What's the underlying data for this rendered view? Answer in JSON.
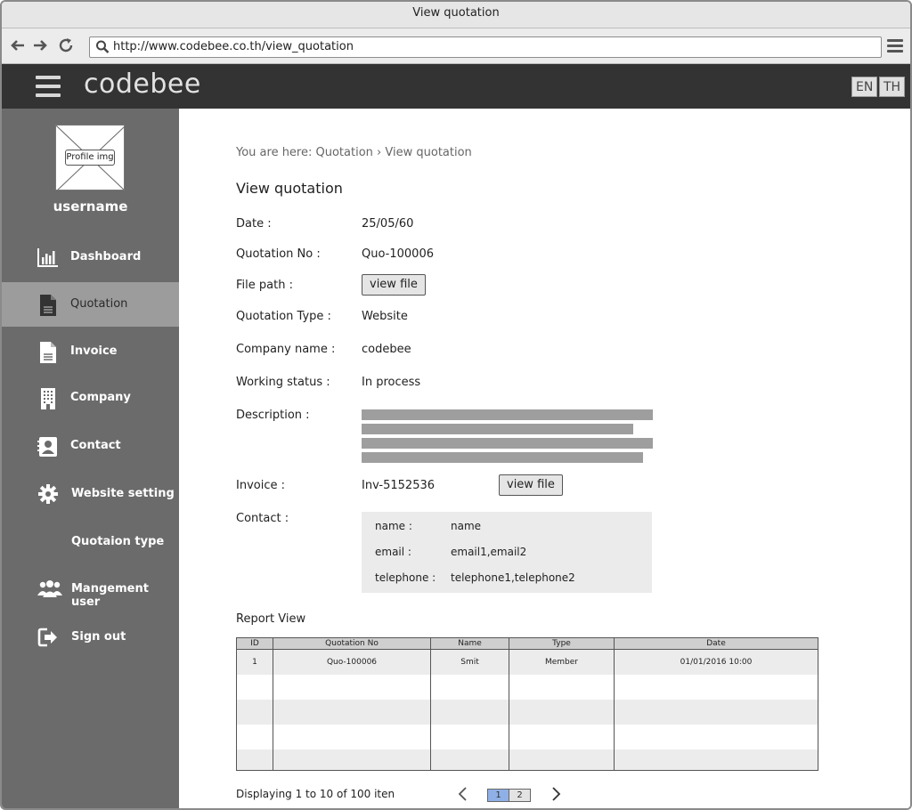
{
  "window": {
    "title": "View quotation"
  },
  "browser": {
    "url": "http://www.codebee.co.th/view_quotation"
  },
  "header": {
    "brand": "codebee",
    "lang_en": "EN",
    "lang_th": "TH"
  },
  "sidebar": {
    "profile_img_label": "Profile img",
    "username": "username",
    "items": [
      {
        "label": "Dashboard",
        "icon": "bar-chart-icon"
      },
      {
        "label": "Quotation",
        "icon": "document-icon"
      },
      {
        "label": "Invoice",
        "icon": "invoice-icon"
      },
      {
        "label": "Company",
        "icon": "building-icon"
      },
      {
        "label": "Contact",
        "icon": "contact-card-icon"
      },
      {
        "label": "Website setting",
        "icon": "gear-icon"
      },
      {
        "label": "Quotaion type",
        "icon": ""
      },
      {
        "label": "Mangement user",
        "icon": "users-icon"
      },
      {
        "label": "Sign out",
        "icon": "sign-out-icon"
      }
    ]
  },
  "main": {
    "breadcrumb": {
      "prefix": "You are here: Quotation",
      "separator": "›",
      "current": "View quotation"
    },
    "title": "View quotation",
    "fields": {
      "date_label": "Date :",
      "date_value": "25/05/60",
      "quotation_no_label": "Quotation No :",
      "quotation_no_value": "Quo-100006",
      "file_path_label": "File path :",
      "file_path_button": "view file",
      "quotation_type_label": "Quotation Type :",
      "quotation_type_value": "Website",
      "company_label": "Company name :",
      "company_value": "codebee",
      "status_label": "Working status :",
      "status_value": "In process",
      "description_label": "Description :",
      "invoice_label": "Invoice :",
      "invoice_value": "Inv-5152536",
      "invoice_button": "view file",
      "contact_label": "Contact :"
    },
    "contact": {
      "name_label": "name :",
      "name_value": "name",
      "email_label": "email :",
      "email_value": "email1,email2",
      "telephone_label": "telephone :",
      "telephone_value": "telephone1,telephone2"
    },
    "report": {
      "title": "Report View",
      "columns": [
        "ID",
        "Quotation No",
        "Name",
        "Type",
        "Date"
      ],
      "rows": [
        [
          "1",
          "Quo-100006",
          "Smit",
          "Member",
          "01/01/2016 10:00"
        ]
      ]
    },
    "pagination": {
      "info": "Displaying 1 to 10 of 100 iten",
      "page1": "1",
      "page2": "2"
    }
  }
}
